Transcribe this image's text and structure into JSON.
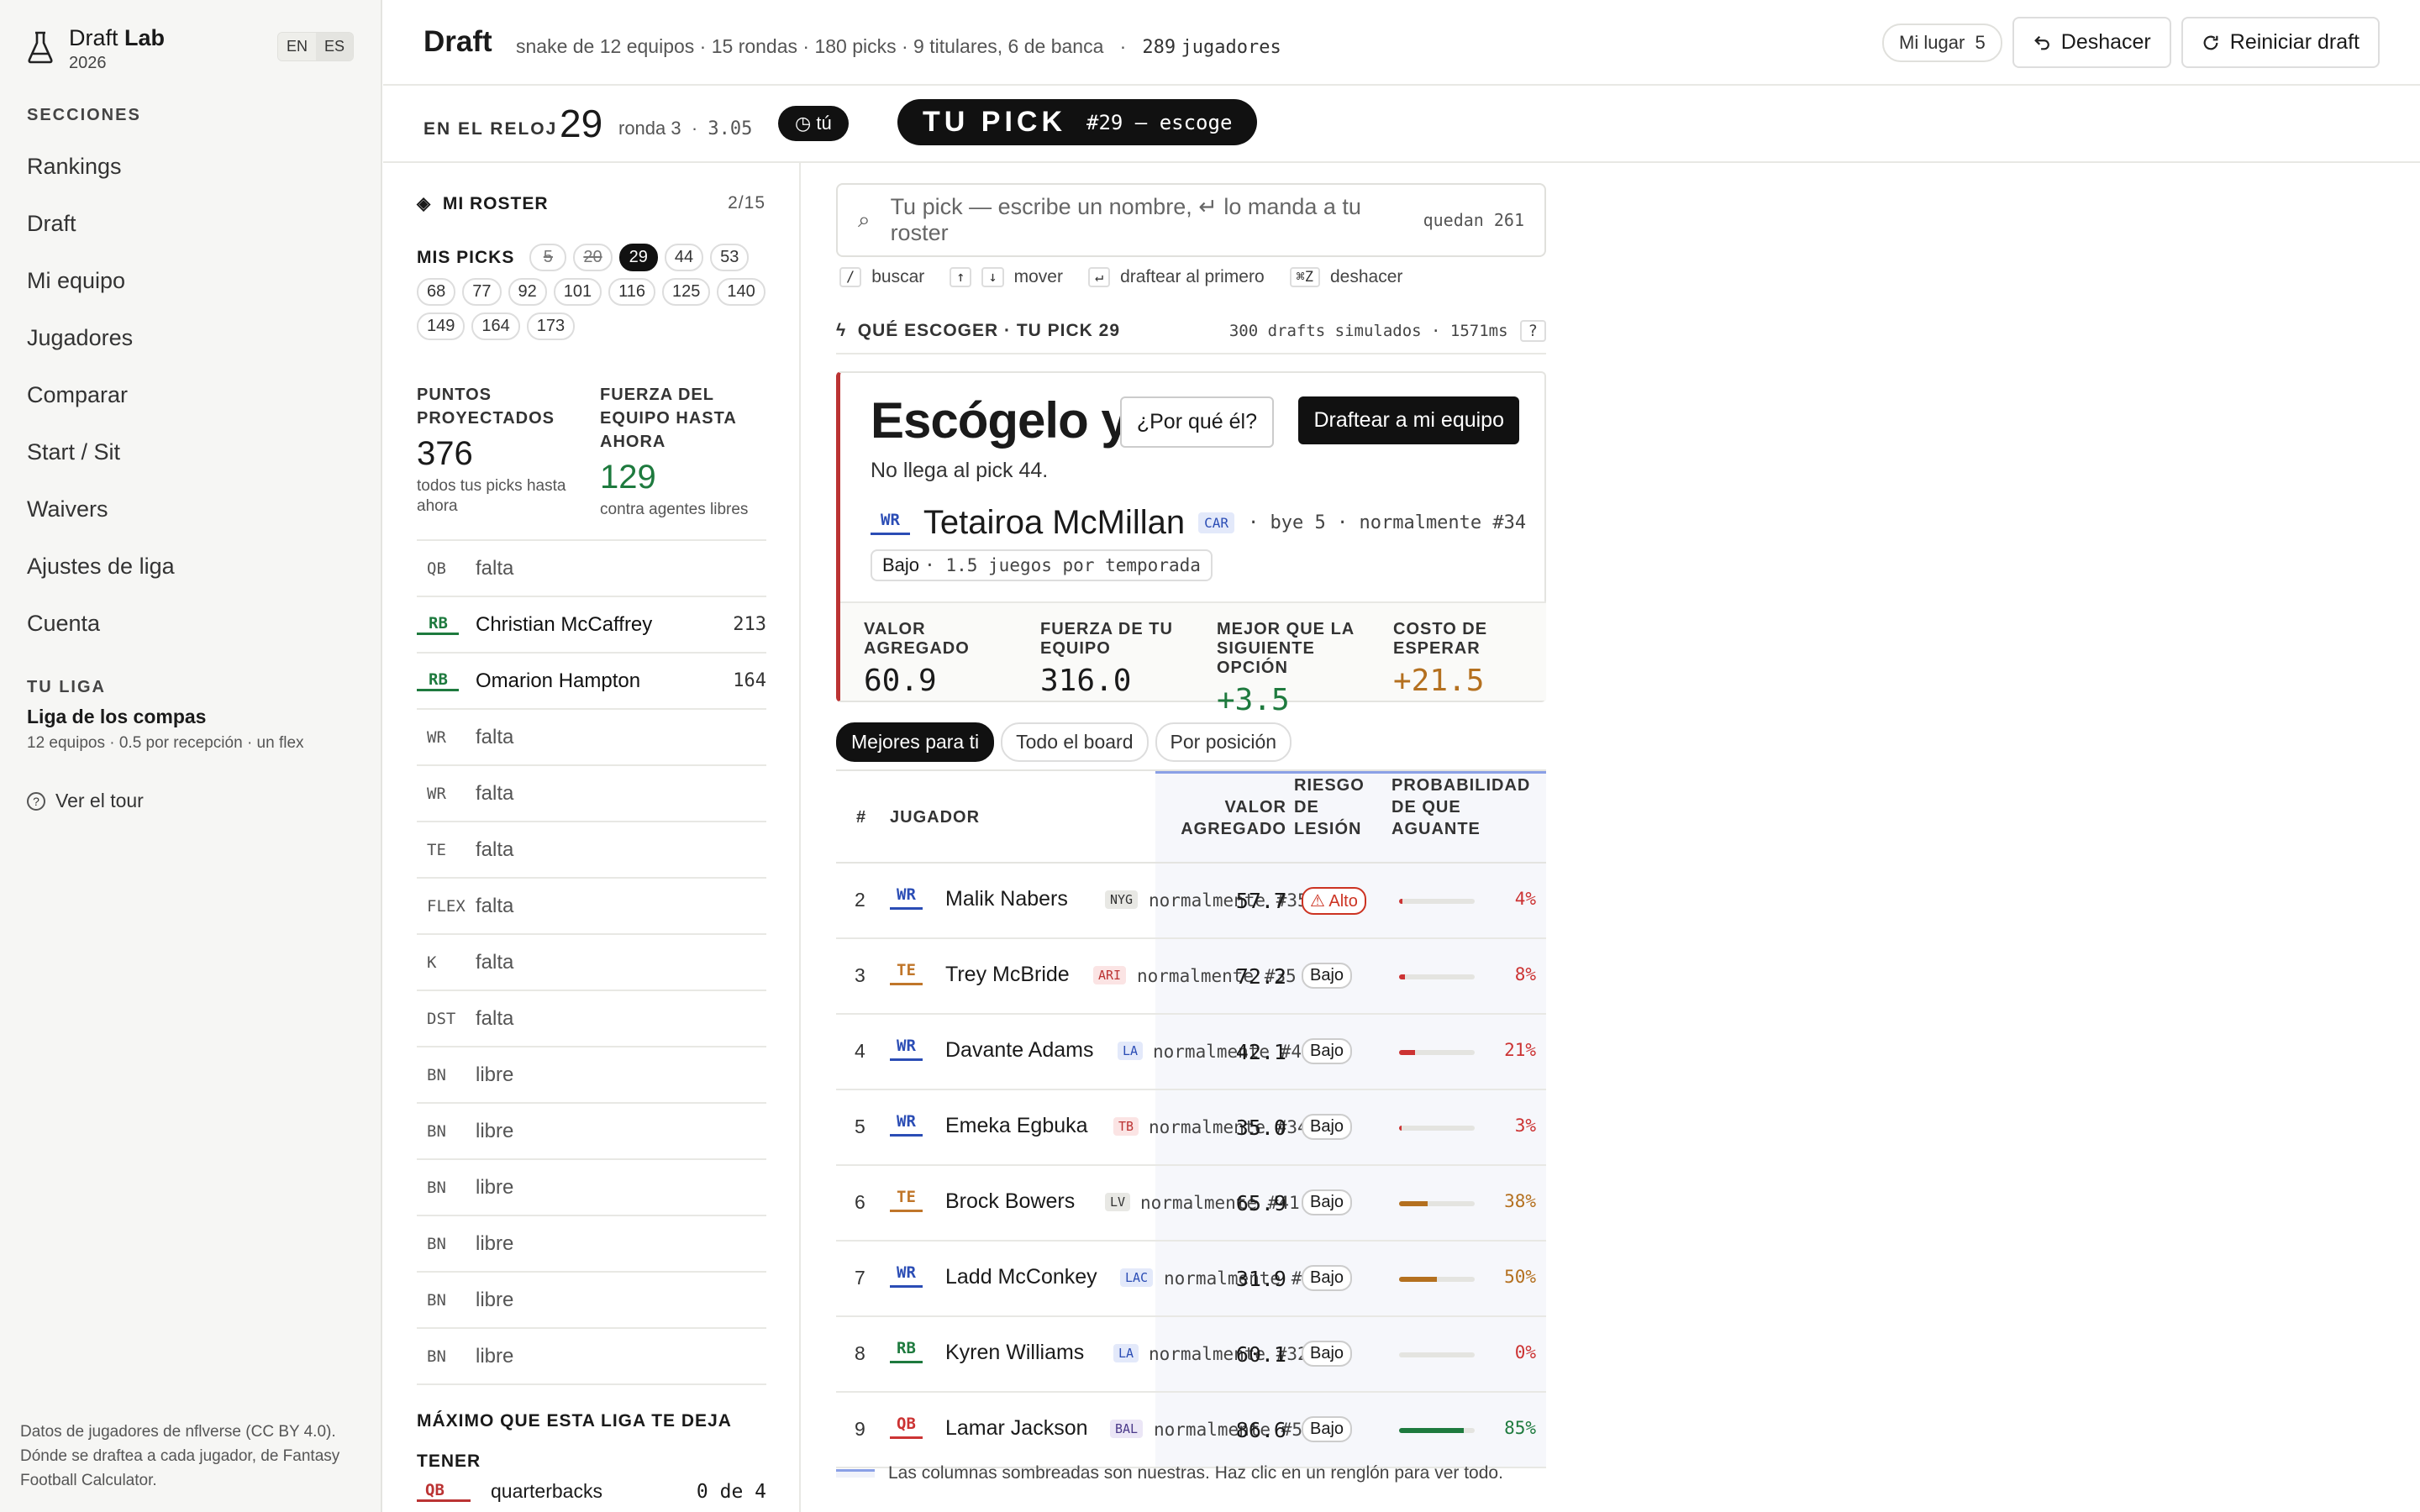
{
  "brand": {
    "name_a": "Draft",
    "name_b": "Lab",
    "year": "2026",
    "lang_en": "EN",
    "lang_es": "ES"
  },
  "sidebar": {
    "section_label": "SECCIONES",
    "items": [
      "Rankings",
      "Draft",
      "Mi equipo",
      "Jugadores",
      "Comparar",
      "Start / Sit",
      "Waivers",
      "Ajustes de liga",
      "Cuenta"
    ],
    "league_label": "TU LIGA",
    "league_name": "Liga de los compas",
    "league_meta": "12 equipos · 0.5 por recepción · un flex",
    "tour": "Ver el tour",
    "credits": "Datos de jugadores de nflverse (CC BY 4.0). Dónde se draftea a cada jugador, de Fantasy Football Calculator."
  },
  "header": {
    "title": "Draft",
    "subtitle": "snake de 12 equipos · 15 rondas · 180 picks · 9 titulares, 6 de banca",
    "sep": "·",
    "players_count": "289",
    "players_word": "jugadores",
    "mi_lugar": "Mi lugar",
    "mi_lugar_val": "5",
    "undo": "Deshacer",
    "reset": "Reiniciar draft"
  },
  "clock": {
    "label": "EN EL RELOJ",
    "pick": "29",
    "round": "ronda 3",
    "sep": "·",
    "slot": "3.05",
    "tu": "tú",
    "tupick": "TU PICK",
    "tupick_sub": "#29 — escoge"
  },
  "roster": {
    "title": "MI ROSTER",
    "count": "2/15",
    "mispicks_label": "MIS PICKS",
    "picks": [
      {
        "n": "5",
        "state": "done"
      },
      {
        "n": "20",
        "state": "done"
      },
      {
        "n": "29",
        "state": "cur"
      },
      {
        "n": "44",
        "state": ""
      },
      {
        "n": "53",
        "state": ""
      },
      {
        "n": "68",
        "state": ""
      },
      {
        "n": "77",
        "state": ""
      },
      {
        "n": "92",
        "state": ""
      },
      {
        "n": "101",
        "state": ""
      },
      {
        "n": "116",
        "state": ""
      },
      {
        "n": "125",
        "state": ""
      },
      {
        "n": "140",
        "state": ""
      },
      {
        "n": "149",
        "state": ""
      },
      {
        "n": "164",
        "state": ""
      },
      {
        "n": "173",
        "state": ""
      }
    ],
    "stat1_label": "PUNTOS PROYECTADOS",
    "stat1_value": "376",
    "stat1_sub": "todos tus picks hasta ahora",
    "stat2_label": "FUERZA DEL EQUIPO HASTA AHORA",
    "stat2_value": "129",
    "stat2_sub": "contra agentes libres",
    "slots": [
      {
        "pos": "QB",
        "name": "falta",
        "pts": ""
      },
      {
        "pos": "RB",
        "name": "Christian McCaffrey",
        "pts": "213"
      },
      {
        "pos": "RB",
        "name": "Omarion Hampton",
        "pts": "164"
      },
      {
        "pos": "WR",
        "name": "falta",
        "pts": ""
      },
      {
        "pos": "WR",
        "name": "falta",
        "pts": ""
      },
      {
        "pos": "TE",
        "name": "falta",
        "pts": ""
      },
      {
        "pos": "FLEX",
        "name": "falta",
        "pts": ""
      },
      {
        "pos": "K",
        "name": "falta",
        "pts": ""
      },
      {
        "pos": "DST",
        "name": "falta",
        "pts": ""
      },
      {
        "pos": "BN",
        "name": "libre",
        "pts": ""
      },
      {
        "pos": "BN",
        "name": "libre",
        "pts": ""
      },
      {
        "pos": "BN",
        "name": "libre",
        "pts": ""
      },
      {
        "pos": "BN",
        "name": "libre",
        "pts": ""
      },
      {
        "pos": "BN",
        "name": "libre",
        "pts": ""
      },
      {
        "pos": "BN",
        "name": "libre",
        "pts": ""
      }
    ],
    "max_label": "MÁXIMO QUE ESTA LIGA TE DEJA TENER",
    "max_pos": "QB",
    "max_name": "quarterbacks",
    "max_val": "0 de 4"
  },
  "search": {
    "placeholder": "Tu pick — escribe un nombre, ↵ lo manda a tu roster",
    "remaining": "quedan 261",
    "k1": "/",
    "s1": "buscar",
    "k2": "↑",
    "k3": "↓",
    "s2": "mover",
    "k4": "↵",
    "s3": "draftear al primero",
    "k5": "⌘Z",
    "s4": "deshacer"
  },
  "suggest": {
    "label": "QUÉ ESCOGER · TU PICK 29",
    "sims": "300 drafts simulados · 1571ms",
    "help": "?",
    "headline": "Escógelo ya",
    "sub": "No llega al pick 44.",
    "why": "¿Por qué él?",
    "draft": "Draftear a mi equipo",
    "pos": "WR",
    "name": "Tetairoa McMillan",
    "team": "CAR",
    "meta": "· bye 5 · normalmente #34",
    "risk": "Bajo",
    "risk_detail": "· 1.5 juegos por temporada",
    "m1_label": "VALOR AGREGADO",
    "m1_value": "60.9",
    "m2_label": "FUERZA DE TU EQUIPO",
    "m2_value": "316.0",
    "m3_label": "MEJOR QUE LA SIGUIENTE OPCIÓN",
    "m3_value": "+3.5",
    "m4_label": "COSTO DE ESPERAR",
    "m4_value": "+21.5"
  },
  "tabs": [
    "Mejores para ti",
    "Todo el board",
    "Por posición"
  ],
  "table": {
    "h_rank": "#",
    "h_player": "JUGADOR",
    "h_val_1": "VALOR",
    "h_val_2": "AGREGADO",
    "h_risk_1": "RIESGO",
    "h_risk_2": "DE",
    "h_risk_3": "LESIÓN",
    "h_prob_1": "PROBABILIDAD",
    "h_prob_2": "DE QUE",
    "h_prob_3": "AGUANTE",
    "rows": [
      {
        "rk": "2",
        "pos": "WR",
        "name": "Malik Nabers",
        "team": "NYG",
        "meta": "normalmente #35",
        "val": "57.7",
        "risk": "⚠ Alto",
        "prob": 4,
        "prob_t": "4%"
      },
      {
        "rk": "3",
        "pos": "TE",
        "name": "Trey McBride",
        "team": "ARI",
        "meta": "normalmente #35",
        "val": "72.2",
        "risk": "Bajo",
        "prob": 8,
        "prob_t": "8%"
      },
      {
        "rk": "4",
        "pos": "WR",
        "name": "Davante Adams",
        "team": "LA",
        "meta": "normalmente #41",
        "val": "42.1",
        "risk": "Bajo",
        "prob": 21,
        "prob_t": "21%"
      },
      {
        "rk": "5",
        "pos": "WR",
        "name": "Emeka Egbuka",
        "team": "TB",
        "meta": "normalmente #34",
        "val": "35.0",
        "risk": "Bajo",
        "prob": 3,
        "prob_t": "3%"
      },
      {
        "rk": "6",
        "pos": "TE",
        "name": "Brock Bowers",
        "team": "LV",
        "meta": "normalmente #41",
        "val": "65.9",
        "risk": "Bajo",
        "prob": 38,
        "prob_t": "38%"
      },
      {
        "rk": "7",
        "pos": "WR",
        "name": "Ladd McConkey",
        "team": "LAC",
        "meta": "normalmente #44",
        "val": "31.9",
        "risk": "Bajo",
        "prob": 50,
        "prob_t": "50%"
      },
      {
        "rk": "8",
        "pos": "RB",
        "name": "Kyren Williams",
        "team": "LA",
        "meta": "normalmente #32",
        "val": "60.1",
        "risk": "Bajo",
        "prob": 0,
        "prob_t": "0%"
      },
      {
        "rk": "9",
        "pos": "QB",
        "name": "Lamar Jackson",
        "team": "BAL",
        "meta": "normalmente #54",
        "val": "86.6",
        "risk": "Bajo",
        "prob": 85,
        "prob_t": "85%"
      }
    ],
    "footnote": "Las columnas sombreadas son nuestras. Haz clic en un renglón para ver todo."
  },
  "colors": {
    "WR": "#2b4db5",
    "TE": "#c0762a",
    "RB": "#1e7a3e",
    "QB": "#c33",
    "team_NYG": "#e8e8e4",
    "team_ARI": "#fbe4e4",
    "team_LA": "#e3e9fa",
    "team_TB": "#fbe4e4",
    "team_LV": "#e8e8e4",
    "team_LAC": "#e3e9fa",
    "team_BAL": "#ebe6f6"
  }
}
